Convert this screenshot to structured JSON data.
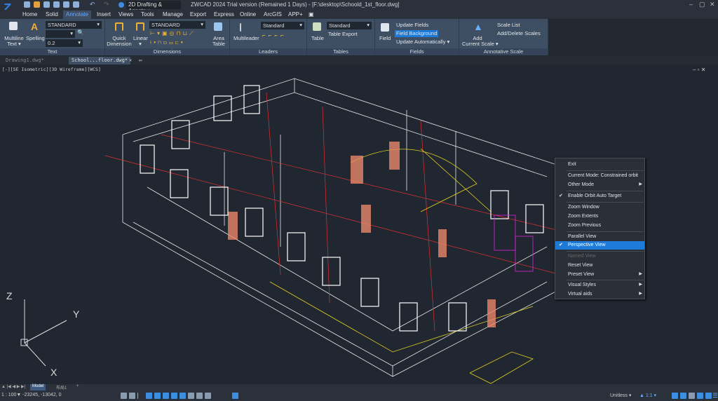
{
  "app": {
    "title": "ZWCAD 2024 Trial version (Remained 1 Days) - [F:\\desktop\\Schoold_1st_floor.dwg]",
    "workspace": "2D Drafting & Annotation",
    "workspace_display": "2D Drafting & Annota"
  },
  "ribbon_tabs": [
    "Home",
    "Solid",
    "Annotate",
    "Insert",
    "Views",
    "Tools",
    "Manage",
    "Export",
    "Express",
    "Online",
    "ArcGIS",
    "APP+"
  ],
  "active_tab": "Annotate",
  "panels": {
    "text": {
      "label": "Text",
      "multiline": "Multiline",
      "multiline2": "Text ▾",
      "spelling": "Spelling",
      "style": "STANDARD",
      "height": "0.2"
    },
    "dimensions": {
      "label": "Dimensions",
      "quick": "Quick",
      "quick2": "Dimension",
      "linear": "Linear",
      "style": "STANDARD",
      "area1": "Area",
      "area2": "Table"
    },
    "leaders": {
      "label": "Leaders",
      "multileader": "Multileader",
      "style": "Standard"
    },
    "tables": {
      "label": "Tables",
      "table": "Table",
      "style": "Standard",
      "export": "Table Export"
    },
    "fields": {
      "label": "Fields",
      "field": "Field",
      "update": "Update Fields",
      "background": "Field Background",
      "auto": "Update Automatically"
    },
    "scale": {
      "label": "Annotative Scale",
      "add1": "Add",
      "add2": "Current Scale ▾",
      "list": "Scale List",
      "adddel": "Add/Delete Scales"
    }
  },
  "doc_tabs": [
    "Drawing1.dwg*",
    "School...floor.dwg*"
  ],
  "viewport_label": "[-][SE Isometric][3D Wireframe][WCS]",
  "axes": {
    "x": "X",
    "y": "Y",
    "z": "Z"
  },
  "context_menu": [
    {
      "label": "Exit"
    },
    {
      "label": "Current Mode: Constrained orbit"
    },
    {
      "label": "Other Mode",
      "submenu": true
    },
    {
      "label": "Enable Orbit Auto Target",
      "checked": true
    },
    {
      "label": "Zoom Window"
    },
    {
      "label": "Zoom Extents"
    },
    {
      "label": "Zoom Previous"
    },
    {
      "label": "Parallel View"
    },
    {
      "label": "Perspective View",
      "checked": true,
      "highlighted": true
    },
    {
      "label": "Named View",
      "disabled": true
    },
    {
      "label": "Reset View"
    },
    {
      "label": "Preset View",
      "submenu": true
    },
    {
      "label": "Visual Styles",
      "submenu": true
    },
    {
      "label": "Virtual aids",
      "submenu": true
    }
  ],
  "layout_tabs": [
    "Model",
    "布局1",
    "+"
  ],
  "status": {
    "coords": "1 : 100▼  -23245, -13042, 0",
    "units": "Unitless",
    "scale": "1:1"
  },
  "colors": {
    "accent": "#1e7ad8",
    "ribbon": "#3e4e63",
    "viewport": "#202731"
  }
}
